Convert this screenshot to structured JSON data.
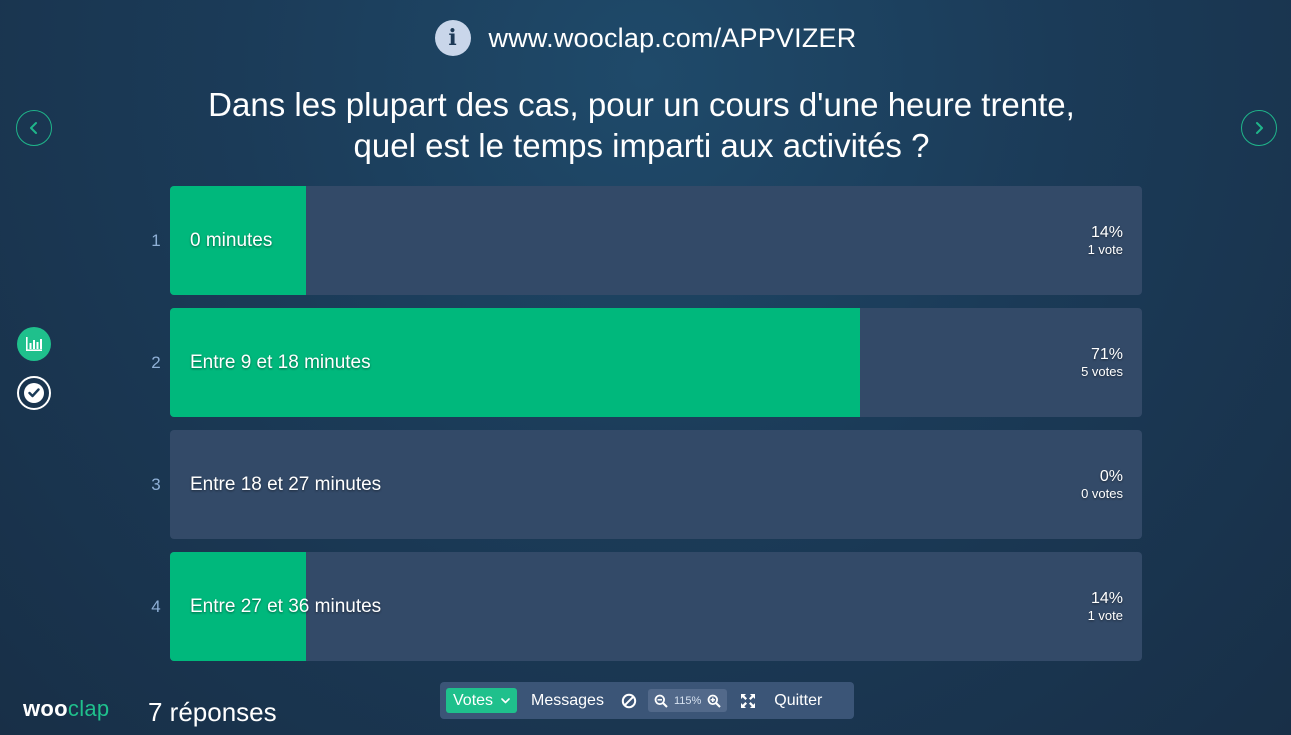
{
  "header": {
    "url": "www.wooclap.com/APPVIZER",
    "info_icon": "info-icon",
    "info_glyph": "i"
  },
  "question": {
    "line1": "Dans les plupart des cas, pour un cours d'une heure trente,",
    "line2": "quel est le temps imparti aux activités ?"
  },
  "navigation": {
    "prev_icon": "chevron-left-icon",
    "next_icon": "chevron-right-icon"
  },
  "side_tools": [
    {
      "icon": "bar-chart-icon"
    },
    {
      "icon": "check-icon"
    }
  ],
  "answers": [
    {
      "index": "1",
      "label": "0 minutes",
      "percent_text": "14%",
      "votes_text": "1 vote",
      "fill_fraction": 0.14
    },
    {
      "index": "2",
      "label": "Entre 9 et 18 minutes",
      "percent_text": "71%",
      "votes_text": "5 votes",
      "fill_fraction": 0.71
    },
    {
      "index": "3",
      "label": "Entre 18 et 27 minutes",
      "percent_text": "0%",
      "votes_text": "0 votes",
      "fill_fraction": 0.0
    },
    {
      "index": "4",
      "label": "Entre 27 et 36 minutes",
      "percent_text": "14%",
      "votes_text": "1 vote",
      "fill_fraction": 0.14
    }
  ],
  "footer": {
    "brand_part1": "woo",
    "brand_part2": "clap",
    "response_count": "7 réponses"
  },
  "toolbar": {
    "votes_label": "Votes",
    "messages_label": "Messages",
    "zoom_level": "115%",
    "quit_label": "Quitter"
  },
  "colors": {
    "accent": "#1fc08c",
    "bar_fill": "#00b87c",
    "bar_track": "#334a68",
    "background": "#1b3b58"
  }
}
